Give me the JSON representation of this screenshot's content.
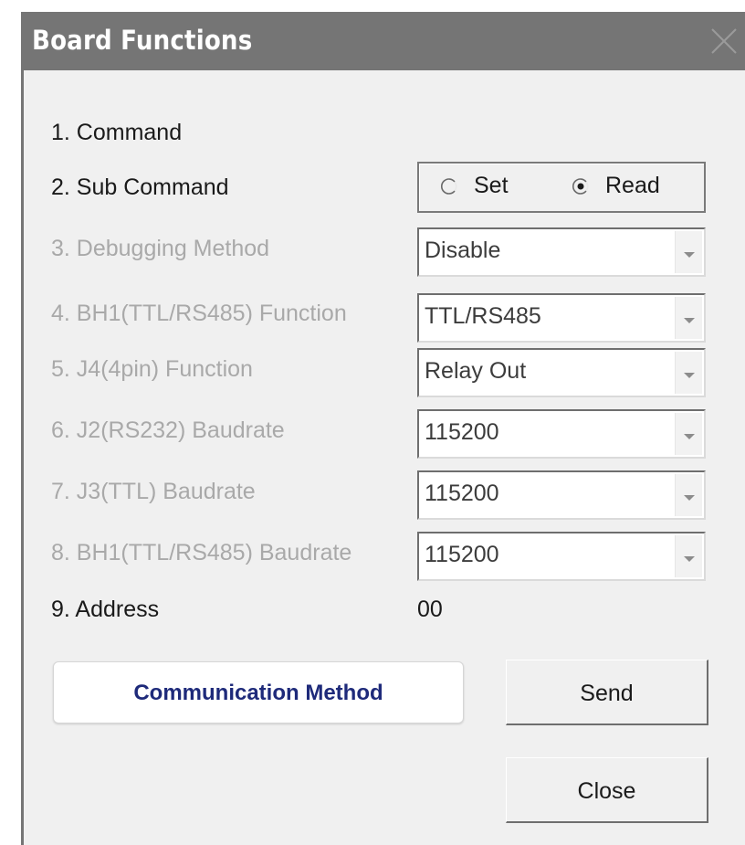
{
  "window": {
    "title": "Board Functions"
  },
  "rows": {
    "command": "1. Command",
    "sub_command": "2. Sub Command",
    "debugging_method": "3. Debugging Method",
    "bh1_function": "4. BH1(TTL/RS485) Function",
    "j4_function": "5. J4(4pin) Function",
    "j2_baudrate": "6. J2(RS232) Baudrate",
    "j3_baudrate": "7. J3(TTL) Baudrate",
    "bh1_baudrate": "8. BH1(TTL/RS485) Baudrate",
    "address": "9. Address"
  },
  "sub_command": {
    "options": [
      "Set",
      "Read"
    ],
    "selected": "Read"
  },
  "values": {
    "debugging_method": "Disable",
    "bh1_function": "TTL/RS485",
    "j4_function": "Relay Out",
    "j2_baudrate": "115200",
    "j3_baudrate": "115200",
    "bh1_baudrate": "115200",
    "address": "00"
  },
  "buttons": {
    "communication_method": "Communication Method",
    "send": "Send",
    "close": "Close"
  },
  "colors": {
    "titlebar": "#757575",
    "disabled_text": "#a9a9a9",
    "comm_button_text": "#1e2a7a"
  },
  "icons": {
    "close": "close-icon",
    "dropdown": "chevron-down-icon",
    "radio": "radio-icon"
  }
}
